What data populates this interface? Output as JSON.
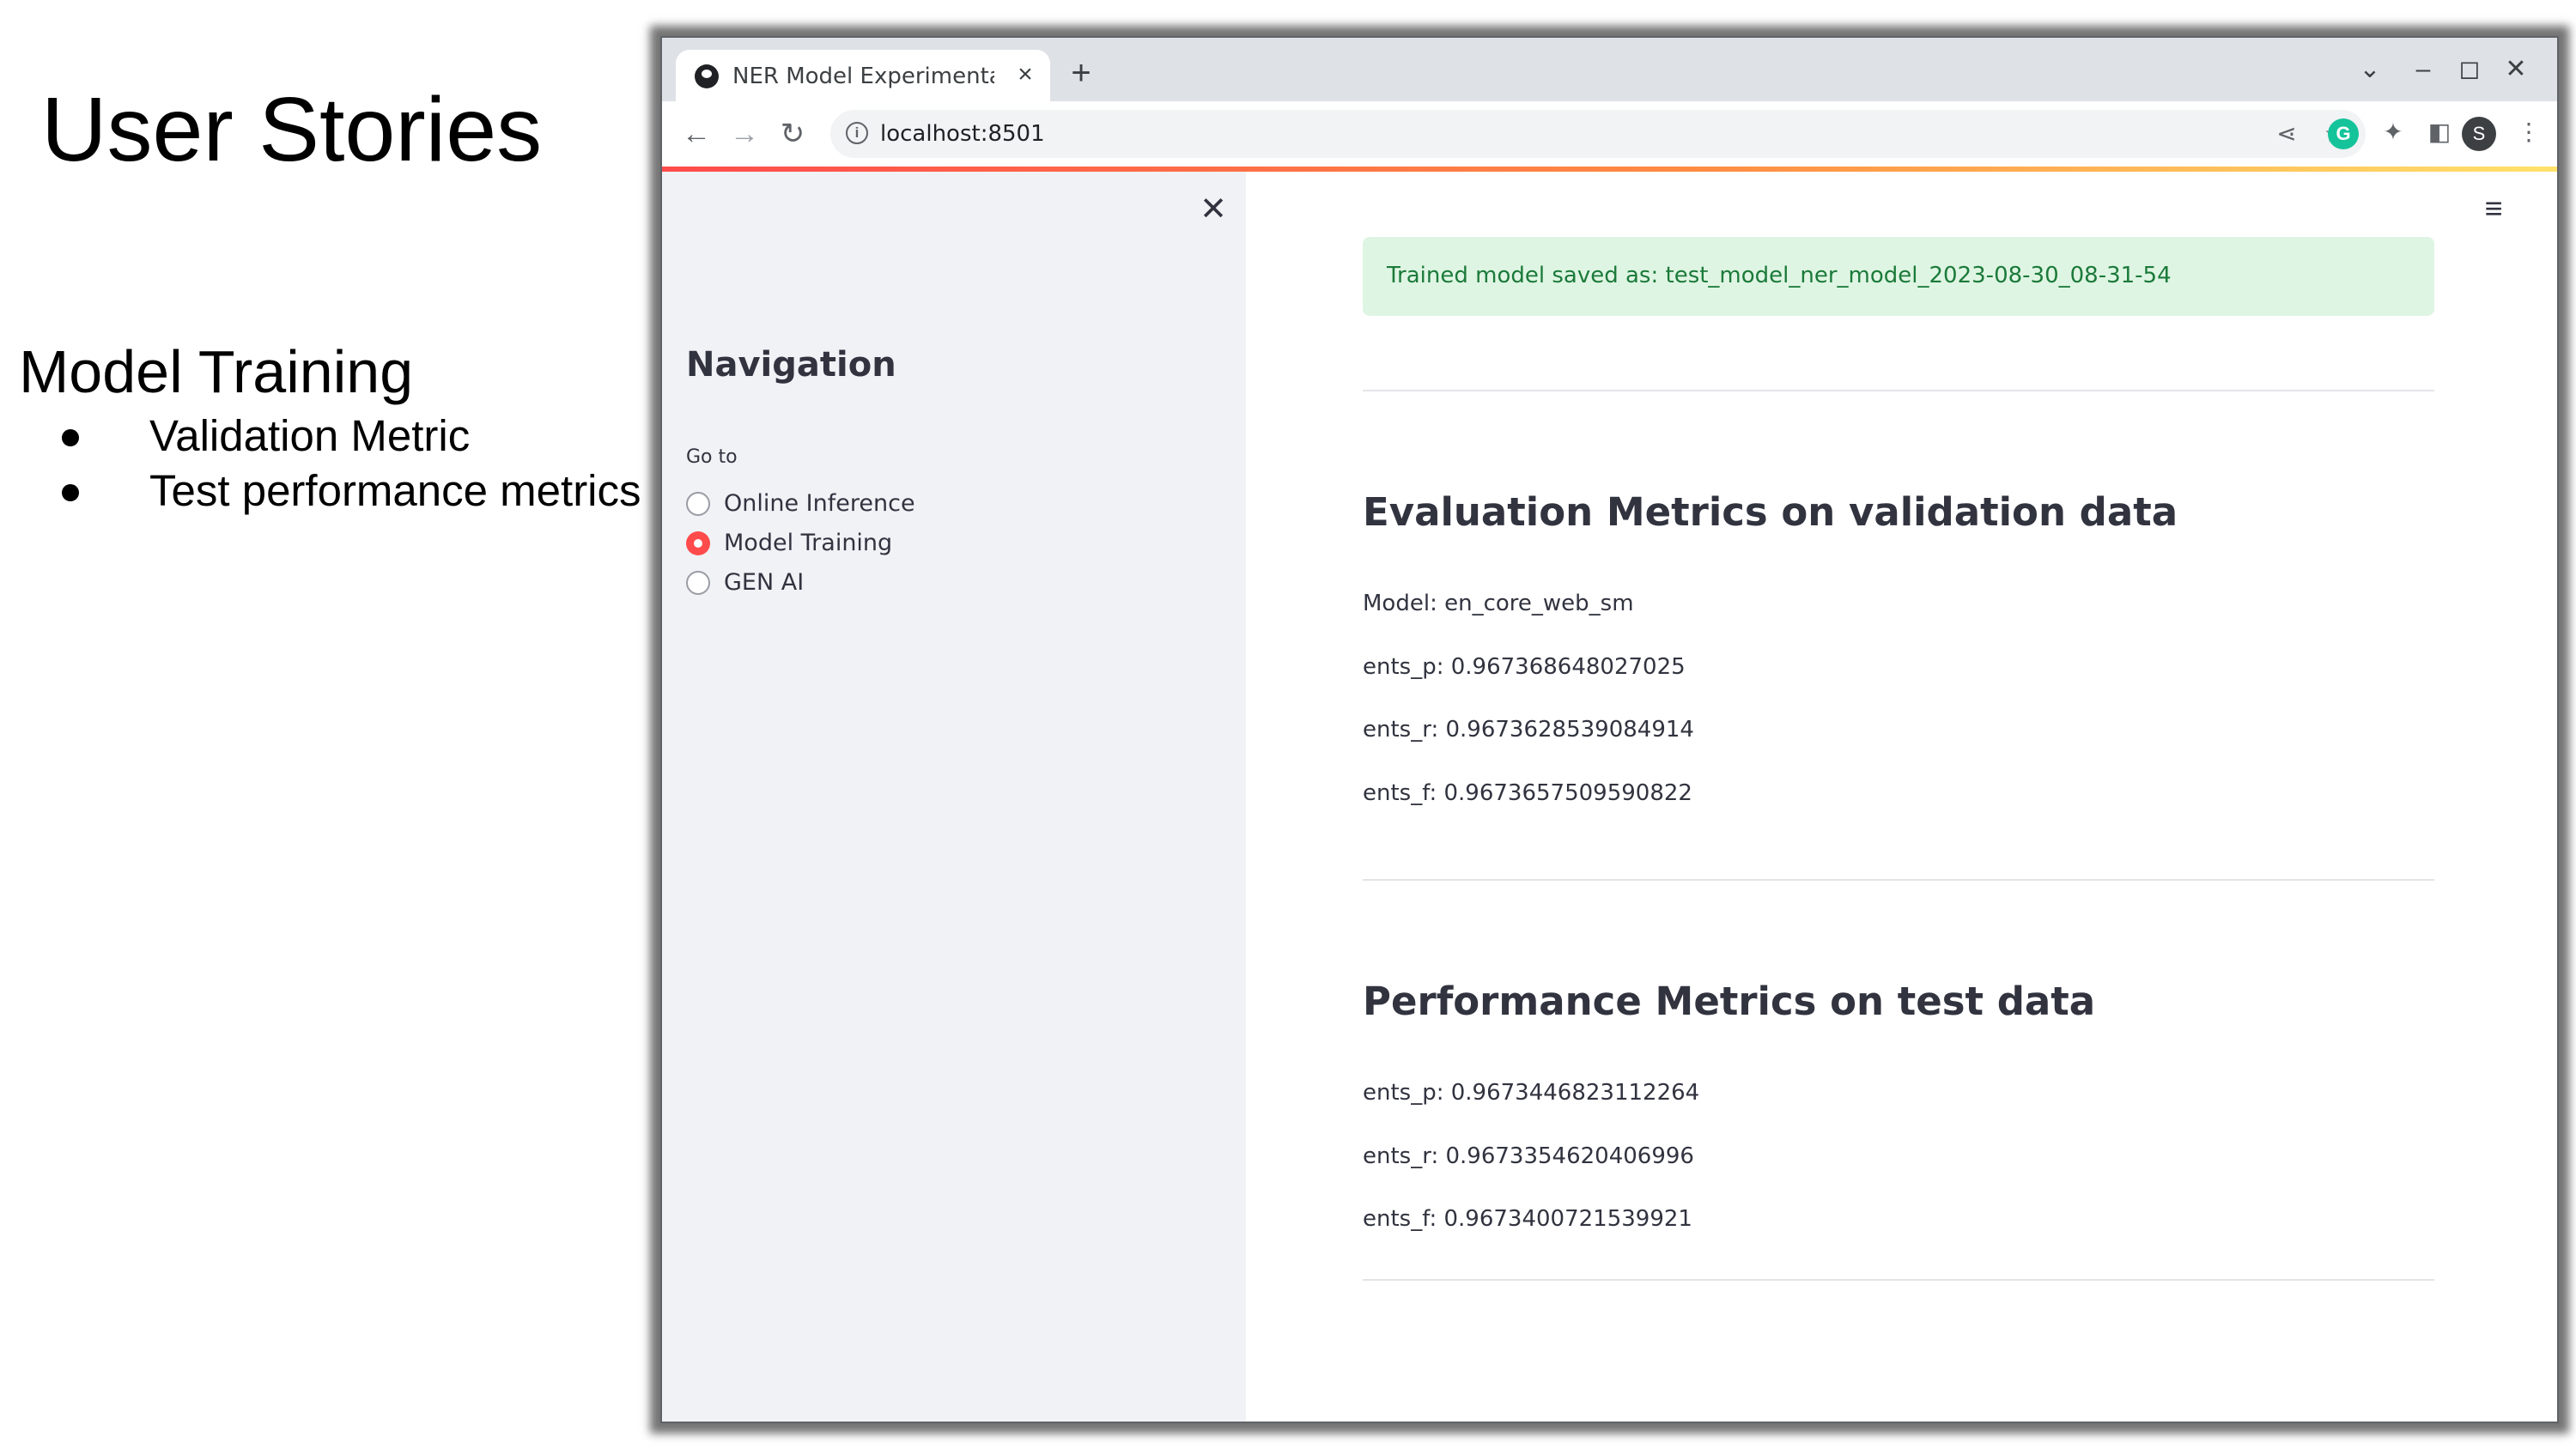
{
  "slide": {
    "title": "User Stories",
    "subtitle": "Model Training",
    "bullets": [
      "Validation Metric",
      "Test performance metrics"
    ]
  },
  "browser": {
    "tab_title": "NER Model Experimentat",
    "url": "localhost:8501",
    "profile_initial": "S",
    "grammarly_letter": "G"
  },
  "sidebar": {
    "heading": "Navigation",
    "goto_label": "Go to",
    "options": [
      "Online Inference",
      "Model Training",
      "GEN AI"
    ],
    "selected": "Model Training"
  },
  "main": {
    "alert": "Trained model saved as: test_model_ner_model_2023-08-30_08-31-54",
    "validation": {
      "title": "Evaluation Metrics on validation data",
      "lines": [
        "Model: en_core_web_sm",
        "ents_p: 0.967368648027025",
        "ents_r: 0.9673628539084914",
        "ents_f: 0.9673657509590822"
      ]
    },
    "test": {
      "title": "Performance Metrics on test data",
      "lines": [
        "ents_p: 0.9673446823112264",
        "ents_r: 0.9673354620406996",
        "ents_f: 0.9673400721539921"
      ]
    }
  },
  "colors": {
    "accent": "#ff4b4b",
    "success_bg": "#dff5e3",
    "success_text": "#1b7a3a",
    "sidebar_bg": "#f0f2f6"
  }
}
